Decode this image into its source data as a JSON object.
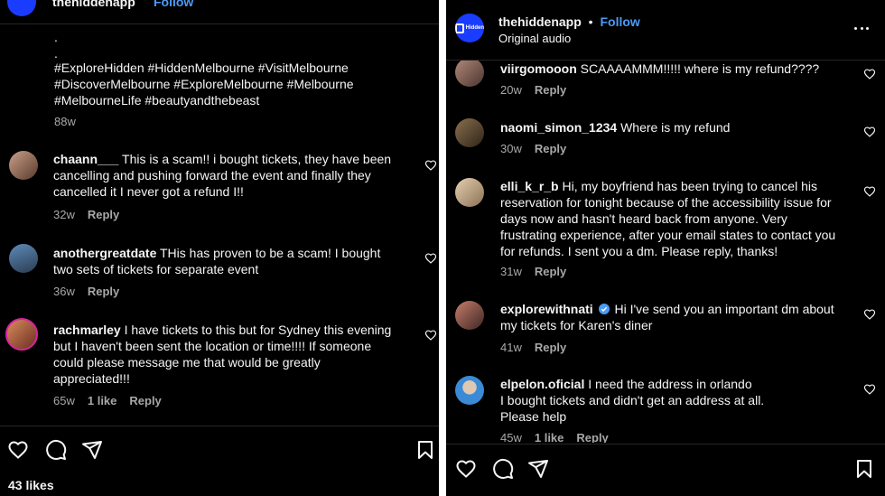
{
  "left": {
    "header": {
      "username": "thehiddenapp",
      "follow": "Follow"
    },
    "caption": {
      "dot1": ".",
      "dot2": ".",
      "hashtags_line1": "#ExploreHidden #HiddenMelbourne #VisitMelbourne",
      "hashtags_line2": "#DiscoverMelbourne #ExploreMelbourne #Melbourne",
      "hashtags_line3": "#MelbourneLife #beautyandthebeast",
      "time": "88w"
    },
    "comments": [
      {
        "username": "chaann___",
        "lines": [
          "This is a scam!! i bought tickets, they have been",
          "cancelling and pushing forward the event and finally they",
          "cancelled it I never got a refund I!!"
        ],
        "time": "32w",
        "likes": "",
        "reply": "Reply"
      },
      {
        "username": "anothergreatdate",
        "lines": [
          "THis has proven to be a scam! I bought",
          "two sets of tickets for separate event"
        ],
        "time": "36w",
        "likes": "",
        "reply": "Reply"
      },
      {
        "username": "rachmarley",
        "lines": [
          "I have tickets to this but for Sydney this evening",
          "but I haven't been sent the location or time!!!! If someone",
          "could please message me that would be greatly",
          "appreciated!!!"
        ],
        "time": "65w",
        "likes": "1 like",
        "reply": "Reply"
      }
    ],
    "likes_count": "43 likes"
  },
  "right": {
    "header": {
      "username": "thehiddenapp",
      "separator": "•",
      "follow": "Follow",
      "subtitle": "Original audio",
      "logo_text": "Hidden"
    },
    "comments": [
      {
        "username": "viirgomooon",
        "lines": [
          "SCAAAAMMM!!!!! where is my refund????"
        ],
        "time": "20w",
        "likes": "",
        "reply": "Reply"
      },
      {
        "username": "naomi_simon_1234",
        "lines": [
          "Where is my refund"
        ],
        "time": "30w",
        "likes": "",
        "reply": "Reply"
      },
      {
        "username": "elli_k_r_b",
        "lines": [
          "Hi, my boyfriend has been trying to cancel his",
          "reservation for tonight because of the accessibility issue for",
          "days now and hasn't heard back from anyone. Very",
          "frustrating experience, after your email states to contact you",
          "for refunds. I sent you a dm. Please reply, thanks!"
        ],
        "time": "31w",
        "likes": "",
        "reply": "Reply"
      },
      {
        "username": "explorewithnati",
        "lines": [
          "Hi I've send you an important dm about",
          "my tickets for Karen's diner"
        ],
        "time": "41w",
        "likes": "",
        "reply": "Reply",
        "verified": true
      },
      {
        "username": "elpelon.oficial",
        "lines": [
          "I need the address in orlando",
          "I bought tickets and didn't get an address at all.",
          "Please help"
        ],
        "time": "45w",
        "likes": "1 like",
        "reply": "Reply"
      }
    ]
  },
  "icons": [
    "heart-icon",
    "comment-icon",
    "share-icon",
    "bookmark-icon",
    "more-icon",
    "verified-icon"
  ],
  "colors": {
    "background": "#000000",
    "text": "#f5f5f5",
    "muted": "#a8a8a8",
    "accent": "#4c9bf5",
    "divider": "#262626",
    "brand": "#1a3cff"
  }
}
